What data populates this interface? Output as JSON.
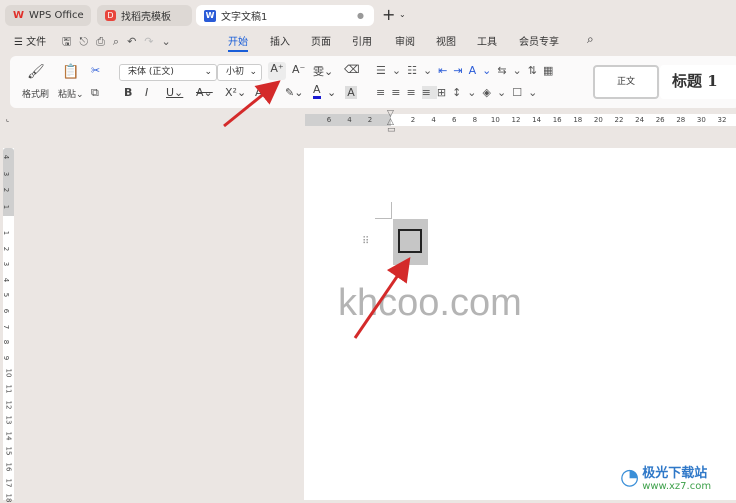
{
  "tabs": [
    {
      "label": "WPS Office",
      "icon": "wps-logo-icon",
      "color": "#e0302a"
    },
    {
      "label": "找稻壳模板",
      "icon": "docer-icon",
      "color": "#e8453c"
    },
    {
      "label": "文字文稿1",
      "icon": "writer-icon",
      "color": "#2a5bd7",
      "active": true
    }
  ],
  "menu": {
    "file": "文件",
    "items": [
      "开始",
      "插入",
      "页面",
      "引用",
      "审阅",
      "视图",
      "工具",
      "会员专享"
    ],
    "active": "开始"
  },
  "ribbon": {
    "format_painter": "格式刷",
    "paste": "粘贴",
    "font_name": "宋体 (正文)",
    "font_size": "小初",
    "style_normal": "正文",
    "style_heading1": "标题 1"
  },
  "ruler": {
    "h_left": [
      "6",
      "4",
      "2"
    ],
    "h_right": [
      "2",
      "4",
      "6",
      "8",
      "10",
      "12",
      "14",
      "16",
      "18",
      "20",
      "22",
      "24",
      "26",
      "28",
      "30",
      "32"
    ],
    "v_top": [
      "4",
      "3",
      "2",
      "1"
    ],
    "v_main": [
      "1",
      "2",
      "3",
      "4",
      "5",
      "6",
      "7",
      "8",
      "9",
      "10",
      "11",
      "12",
      "13",
      "14",
      "15",
      "16",
      "17",
      "18"
    ]
  },
  "document": {
    "watermark": "khcoo.com"
  },
  "site_logo": {
    "name": "极光下载站",
    "url": "www.xz7.com"
  },
  "colors": {
    "accent": "#1a5ed8",
    "arrow": "#d42a2a",
    "font_color_bar": "#1a1ad0"
  }
}
